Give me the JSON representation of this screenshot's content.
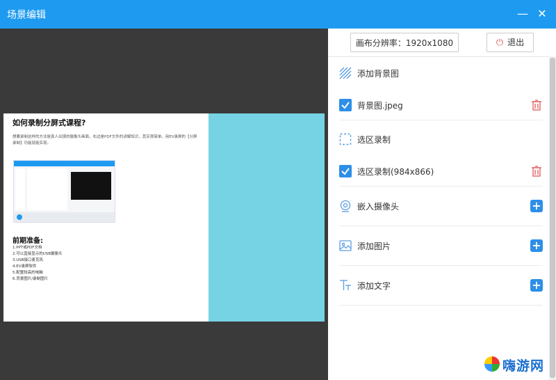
{
  "window": {
    "title": "场景编辑",
    "minimize_glyph": "—",
    "close_glyph": "✕"
  },
  "scene_preview": {
    "heading": "如何录制分屏式课程?",
    "paragraph": "想要录制这样的方法是真人出镜的摄像头画面，右边是PDF文件的讲解知识，其实很简单。用EV录屏的【分屏录制】功能就能实现。",
    "section_title": "前期准备:",
    "list": [
      "1.PPT或PDF文档",
      "2.可以直接显示的USB摄像头",
      "3.USB接口麦克风",
      "4.EV录屏软件",
      "5.配置较高的电脑",
      "6.背景图片/录制图片"
    ]
  },
  "panel": {
    "resolution_label": "画布分辨率：",
    "resolution_value": "1920x1080",
    "exit_label": "退出",
    "items": [
      {
        "label": "添加背景图",
        "icon": "background-pattern-icon",
        "action": null
      },
      {
        "label": "背景图.jpeg",
        "icon": "checkbox-checked-icon",
        "action": "delete-icon"
      },
      {
        "label": "选区录制",
        "icon": "dashed-selection-icon",
        "action": null
      },
      {
        "label": "选区录制(984x866)",
        "icon": "checkbox-checked-icon",
        "action": "delete-icon"
      },
      {
        "label": "嵌入摄像头",
        "icon": "camera-icon",
        "action": "add-icon"
      },
      {
        "label": "添加图片",
        "icon": "image-icon",
        "action": "add-icon"
      },
      {
        "label": "添加文字",
        "icon": "text-icon",
        "action": "add-icon"
      }
    ]
  },
  "watermark": {
    "text": "嗨游网"
  },
  "colors": {
    "titlebar": "#1e9bf0",
    "accent": "#2d8fe6",
    "delete": "#e05a5a",
    "canvas_bg": "#3a3a3a",
    "scene_cyan": "#76d3e4"
  }
}
